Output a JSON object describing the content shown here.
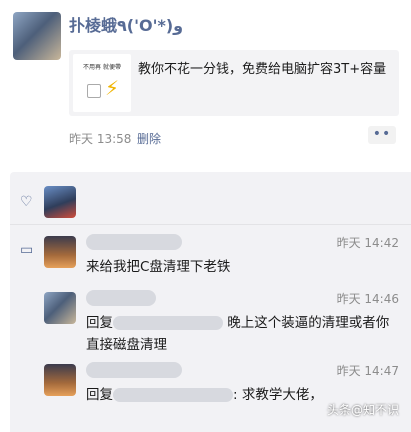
{
  "post": {
    "author": "扑棱蛾٩('O'*)و",
    "share_card": {
      "thumb_title": "不用再 就便帶",
      "text": "教你不花一分钱，免费给电脑扩容3T+容量"
    },
    "time": "昨天 13:58",
    "delete_label": "删除",
    "more_label": "••"
  },
  "interactions": {
    "comments": [
      {
        "time": "昨天 14:42",
        "text": "来给我把C盘清理下老铁"
      },
      {
        "time": "昨天 14:46",
        "reply_label": "回复",
        "text": "晚上这个装逼的清理或者你直接磁盘清理"
      },
      {
        "time": "昨天 14:47",
        "reply_label": "回复",
        "text": ": 求教学大佬，"
      }
    ]
  },
  "watermark": "头条@知不识"
}
